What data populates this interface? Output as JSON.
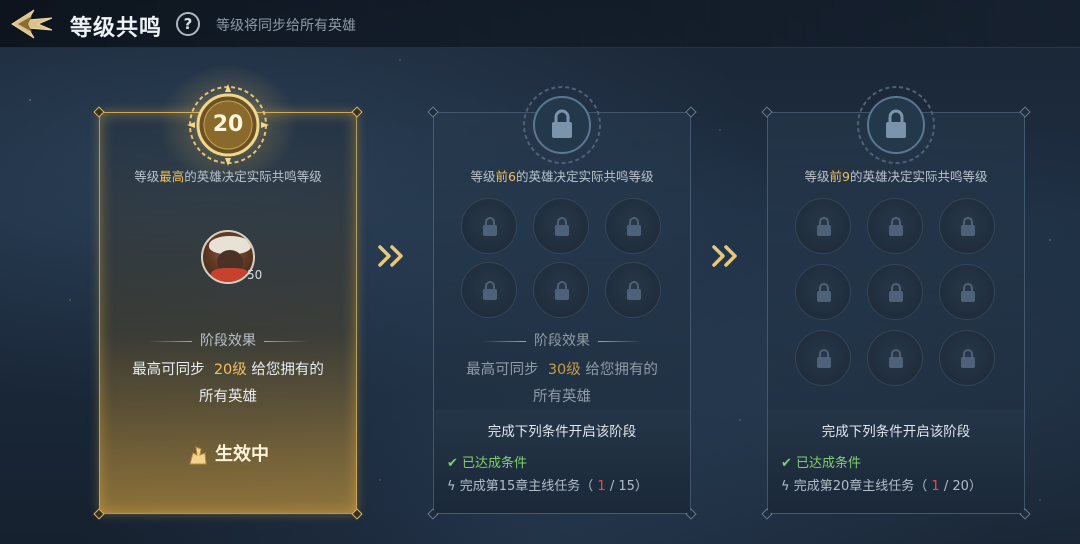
{
  "header": {
    "title": "等级共鸣",
    "help_symbol": "?",
    "subtitle": "等级将同步给所有英雄"
  },
  "cards": [
    {
      "state": "active",
      "level": "20",
      "condition_prefix": "等级",
      "condition_highlight": "最高",
      "condition_suffix": "的英雄决定实际共鸣等级",
      "hero_level": "50",
      "phase_title": "阶段效果",
      "effect_prefix": "最高可同步",
      "effect_value": "20级",
      "effect_suffix": "给您拥有的",
      "effect_line2": "所有英雄",
      "status_label": "生效中"
    },
    {
      "state": "locked",
      "condition_prefix": "等级",
      "condition_highlight": "前6",
      "condition_suffix": "的英雄决定实际共鸣等级",
      "slot_count": 6,
      "phase_title": "阶段效果",
      "effect_prefix": "最高可同步",
      "effect_value": "30级",
      "effect_suffix": "给您拥有的",
      "effect_line2": "所有英雄",
      "req_title": "完成下列条件开启该阶段",
      "req_done": "已达成条件",
      "req_task_label": "完成第15章主线任务",
      "req_progress_current": "1",
      "req_progress_total": "15"
    },
    {
      "state": "locked",
      "condition_prefix": "等级",
      "condition_highlight": "前9",
      "condition_suffix": "的英雄决定实际共鸣等级",
      "slot_count": 9,
      "req_title": "完成下列条件开启该阶段",
      "req_done": "已达成条件",
      "req_task_label": "完成第20章主线任务",
      "req_progress_current": "1",
      "req_progress_total": "20"
    }
  ],
  "colors": {
    "accent_gold": "#f3c05c",
    "done_green": "#7fd06c",
    "progress_red": "#ee4a3c"
  }
}
